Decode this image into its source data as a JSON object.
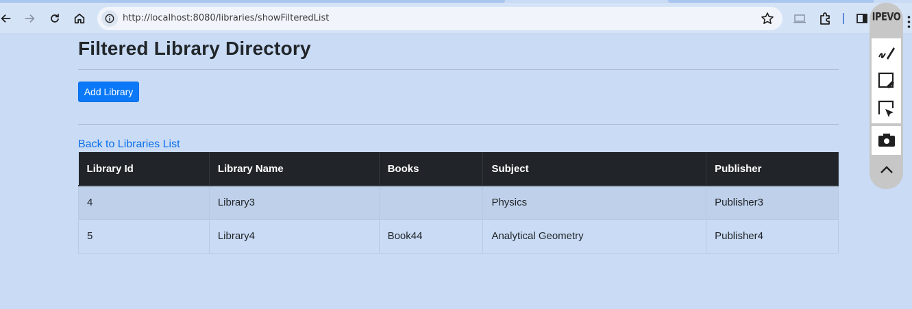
{
  "browser": {
    "url": "http://localhost:8080/libraries/showFilteredList",
    "nav_icons": [
      "back-arrow-icon",
      "forward-arrow-icon",
      "reload-icon",
      "home-icon"
    ],
    "right_icons": [
      "bookmark-star-icon",
      "cast-icon",
      "extensions-icon",
      "side-panel-icon",
      "kebab-menu-icon"
    ]
  },
  "ipevo_panel": {
    "logo": "IPEVO",
    "tools": [
      "annotate-icon",
      "screenshot-draw-icon",
      "region-select-icon",
      "camera-icon",
      "collapse-up-icon"
    ]
  },
  "page": {
    "title": "Filtered Library Directory",
    "add_button_label": "Add Library",
    "back_link_label": "Back to Libraries List"
  },
  "table": {
    "headers": [
      "Library Id",
      "Library Name",
      "Books",
      "Subject",
      "Publisher"
    ],
    "rows": [
      [
        "4",
        "Library3",
        "",
        "Physics",
        "Publisher3"
      ],
      [
        "5",
        "Library4",
        "Book44",
        "Analytical Geometry",
        "Publisher4"
      ]
    ]
  },
  "colors": {
    "page_background": "#c9dbf5",
    "primary_button": "#0b79f7",
    "table_header": "#212529",
    "link": "#0b6fe8"
  }
}
